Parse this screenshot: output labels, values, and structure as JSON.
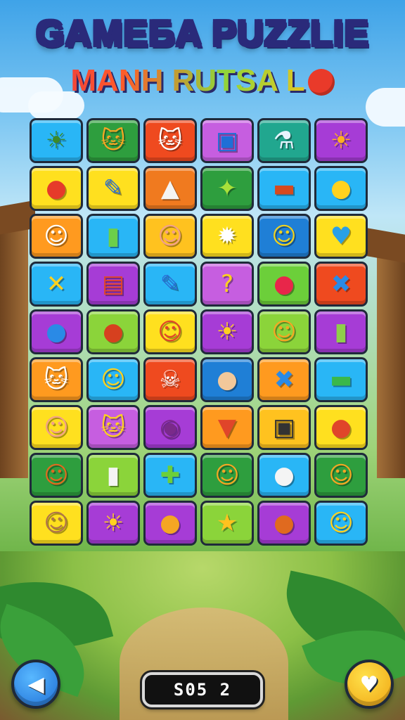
{
  "header": {
    "title": "GAMEБA PUZZLIE",
    "subtitle": "MANH RUTSA L",
    "subtitle_face_icon": "red-smiley-face-icon"
  },
  "board": {
    "rows": [
      [
        {
          "icon": "sun-face-icon",
          "glyph": "☀",
          "color": "#29b6f6",
          "fg": "#3d8a2a"
        },
        {
          "icon": "cat-face-icon",
          "glyph": "🐱",
          "color": "#2e9e3e",
          "fg": "#f5a623"
        },
        {
          "icon": "white-cat-face-icon",
          "glyph": "🐱",
          "color": "#ef4a1f",
          "fg": "#ffffff"
        },
        {
          "icon": "picture-frame-icon",
          "glyph": "▣",
          "color": "#c65ee0",
          "fg": "#1f6fd6"
        },
        {
          "icon": "bottle-brush-icon",
          "glyph": "⚗",
          "color": "#21a78f",
          "fg": "#e8f4ff"
        },
        {
          "icon": "sun-face-icon",
          "glyph": "☀",
          "color": "#a63cd6",
          "fg": "#ffb020"
        }
      ],
      [
        {
          "icon": "apple-icon",
          "glyph": "●",
          "color": "#ffe01f",
          "fg": "#e63a2a"
        },
        {
          "icon": "pencil-icon",
          "glyph": "✎",
          "color": "#ffe01f",
          "fg": "#2a6fd6"
        },
        {
          "icon": "cone-icon",
          "glyph": "▲",
          "color": "#f07a1f",
          "fg": "#f4f4f4"
        },
        {
          "icon": "star-icon",
          "glyph": "✦",
          "color": "#2e9e3e",
          "fg": "#a8e03a"
        },
        {
          "icon": "bread-icon",
          "glyph": "▬",
          "color": "#29b6f6",
          "fg": "#d64a1f"
        },
        {
          "icon": "lemon-icon",
          "glyph": "●",
          "color": "#29b6f6",
          "fg": "#ffd21f"
        }
      ],
      [
        {
          "icon": "ghost-face-icon",
          "glyph": "☺",
          "color": "#ff9a1f",
          "fg": "#ffffff"
        },
        {
          "icon": "battery-icon",
          "glyph": "▮",
          "color": "#29b6f6",
          "fg": "#6ccf4a"
        },
        {
          "icon": "monkey-face-icon",
          "glyph": "☺",
          "color": "#ffc21f",
          "fg": "#f2a08a"
        },
        {
          "icon": "white-sun-icon",
          "glyph": "✹",
          "color": "#ffe01f",
          "fg": "#ffffff"
        },
        {
          "icon": "frog-face-icon",
          "glyph": "☺",
          "color": "#1f7fd6",
          "fg": "#f0d21f"
        },
        {
          "icon": "heart-bubble-icon",
          "glyph": "♥",
          "color": "#ffe01f",
          "fg": "#29a0e6"
        }
      ],
      [
        {
          "icon": "x-mark-icon",
          "glyph": "✕",
          "color": "#29b6f6",
          "fg": "#ffd21f"
        },
        {
          "icon": "treasure-chest-icon",
          "glyph": "▤",
          "color": "#a63cd6",
          "fg": "#e0452a"
        },
        {
          "icon": "pencil-icon",
          "glyph": "✎",
          "color": "#29b6f6",
          "fg": "#2a6fd6"
        },
        {
          "icon": "question-mark-icon",
          "glyph": "?",
          "color": "#c65ee0",
          "fg": "#ffd21f"
        },
        {
          "icon": "apple-icon",
          "glyph": "●",
          "color": "#6ccf3a",
          "fg": "#e8264a"
        },
        {
          "icon": "crossed-tools-icon",
          "glyph": "✖",
          "color": "#ef4a1f",
          "fg": "#2a8ae6"
        }
      ],
      [
        {
          "icon": "blue-blob-icon",
          "glyph": "●",
          "color": "#a63cd6",
          "fg": "#2a8ae6"
        },
        {
          "icon": "acorn-face-icon",
          "glyph": "●",
          "color": "#8bd43a",
          "fg": "#d6401f"
        },
        {
          "icon": "monkey-face-icon",
          "glyph": "☺",
          "color": "#ffe01f",
          "fg": "#e0452a"
        },
        {
          "icon": "sun-face-icon",
          "glyph": "☀",
          "color": "#a63cd6",
          "fg": "#ffd21f"
        },
        {
          "icon": "orange-face-icon",
          "glyph": "☺",
          "color": "#8bd43a",
          "fg": "#f5a623"
        },
        {
          "icon": "battery-icon",
          "glyph": "▮",
          "color": "#a63cd6",
          "fg": "#8fcf4a"
        }
      ],
      [
        {
          "icon": "white-cat-face-icon",
          "glyph": "🐱",
          "color": "#ff9a1f",
          "fg": "#ffffff"
        },
        {
          "icon": "smiley-face-icon",
          "glyph": "☺",
          "color": "#29b6f6",
          "fg": "#ffd21f"
        },
        {
          "icon": "spotted-ghost-icon",
          "glyph": "☠",
          "color": "#ef4a1f",
          "fg": "#ffffff"
        },
        {
          "icon": "potato-icon",
          "glyph": "●",
          "color": "#1f7fd6",
          "fg": "#f2c89a"
        },
        {
          "icon": "crossed-swords-icon",
          "glyph": "✖",
          "color": "#ff9a1f",
          "fg": "#2a8ae6"
        },
        {
          "icon": "green-dish-icon",
          "glyph": "▬",
          "color": "#29b6f6",
          "fg": "#3ab84a"
        }
      ],
      [
        {
          "icon": "pig-face-icon",
          "glyph": "☺",
          "color": "#ffe01f",
          "fg": "#f2a08a"
        },
        {
          "icon": "cat-face-icon",
          "glyph": "🐱",
          "color": "#c65ee0",
          "fg": "#ffd21f"
        },
        {
          "icon": "drum-icon",
          "glyph": "◉",
          "color": "#a63cd6",
          "fg": "#7a2a8a"
        },
        {
          "icon": "carrot-icon",
          "glyph": "▼",
          "color": "#ff9a1f",
          "fg": "#e0452a"
        },
        {
          "icon": "tablet-icon",
          "glyph": "▣",
          "color": "#ffc21f",
          "fg": "#333333"
        },
        {
          "icon": "sausage-icon",
          "glyph": "●",
          "color": "#ffe01f",
          "fg": "#e0452a"
        }
      ],
      [
        {
          "icon": "teddy-bear-icon",
          "glyph": "☺",
          "color": "#2e9e3e",
          "fg": "#e06a1f"
        },
        {
          "icon": "eraser-icon",
          "glyph": "▮",
          "color": "#8bd43a",
          "fg": "#f4f4f4"
        },
        {
          "icon": "cactus-icon",
          "glyph": "✚",
          "color": "#29b6f6",
          "fg": "#6ccf3a"
        },
        {
          "icon": "bear-face-icon",
          "glyph": "☺",
          "color": "#2e9e3e",
          "fg": "#f5a623"
        },
        {
          "icon": "speech-bubble-icon",
          "glyph": "●",
          "color": "#29b6f6",
          "fg": "#f4f4f4"
        },
        {
          "icon": "bear-face-icon",
          "glyph": "☺",
          "color": "#2e9e3e",
          "fg": "#f5a623"
        }
      ],
      [
        {
          "icon": "girl-face-icon",
          "glyph": "☺",
          "color": "#ffe01f",
          "fg": "#b0744a"
        },
        {
          "icon": "sun-face-icon",
          "glyph": "☀",
          "color": "#a63cd6",
          "fg": "#ffd21f"
        },
        {
          "icon": "sweet-potato-icon",
          "glyph": "●",
          "color": "#a63cd6",
          "fg": "#f5a623"
        },
        {
          "icon": "star-icon",
          "glyph": "★",
          "color": "#8bd43a",
          "fg": "#ffc21f"
        },
        {
          "icon": "drumstick-icon",
          "glyph": "●",
          "color": "#a63cd6",
          "fg": "#e06a1f"
        },
        {
          "icon": "smiley-face-icon",
          "glyph": "☺",
          "color": "#29b6f6",
          "fg": "#ffd21f"
        }
      ]
    ]
  },
  "footer": {
    "back_button_icon": "back-arrow-icon",
    "back_glyph": "◀",
    "score_text": "S05 2",
    "hint_button_icon": "heart-chevron-icon",
    "hint_glyph": "♥"
  }
}
